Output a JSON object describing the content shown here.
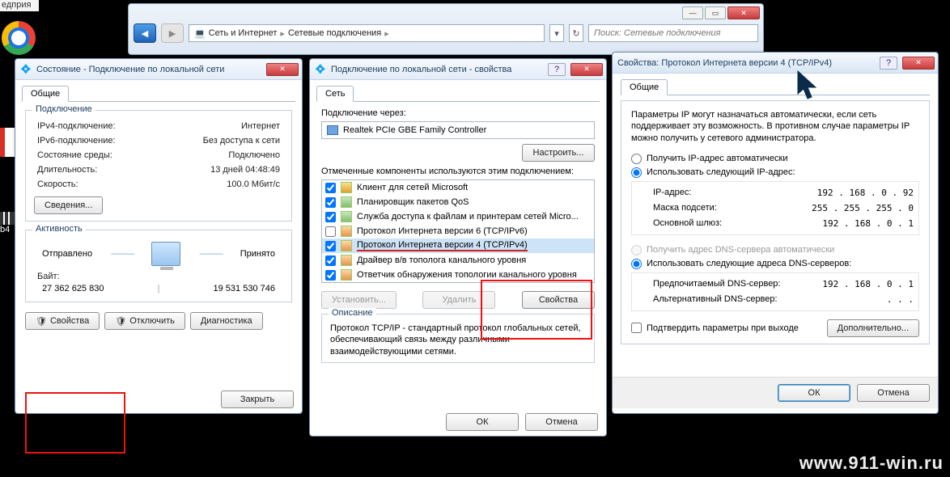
{
  "desktop": {
    "frag": "едприя",
    "b4": "b4"
  },
  "watermark": "www.911-win.ru",
  "explorer": {
    "path1": "Сеть и Интернет",
    "path2": "Сетевые подключения",
    "search_placeholder": "Поиск: Сетевые подключения"
  },
  "status": {
    "title": "Состояние - Подключение по локальной сети",
    "tab": "Общие",
    "grp_connection": "Подключение",
    "ipv4_k": "IPv4-подключение:",
    "ipv4_v": "Интернет",
    "ipv6_k": "IPv6-подключение:",
    "ipv6_v": "Без доступа к сети",
    "media_k": "Состояние среды:",
    "media_v": "Подключено",
    "dur_k": "Длительность:",
    "dur_v": "13 дней 04:48:49",
    "speed_k": "Скорость:",
    "speed_v": "100.0 Мбит/с",
    "details_btn": "Сведения...",
    "grp_activity": "Активность",
    "sent_lbl": "Отправлено",
    "recv_lbl": "Принято",
    "bytes_lbl": "Байт:",
    "bytes_sent": "27 362 625 830",
    "bytes_recv": "19 531 530 746",
    "btn_props": "Свойства",
    "btn_disable": "Отключить",
    "btn_diag": "Диагностика",
    "btn_close": "Закрыть"
  },
  "props": {
    "title": "Подключение по локальной сети - свойства",
    "tab": "Сеть",
    "connect_via": "Подключение через:",
    "adapter": "Realtek PCIe GBE Family Controller",
    "btn_configure": "Настроить...",
    "comp_label": "Отмеченные компоненты используются этим подключением:",
    "components": [
      {
        "checked": true,
        "label": "Клиент для сетей Microsoft"
      },
      {
        "checked": true,
        "label": "Планировщик пакетов QoS"
      },
      {
        "checked": true,
        "label": "Служба доступа к файлам и принтерам сетей Micro..."
      },
      {
        "checked": false,
        "label": "Протокол Интернета версии 6 (TCP/IPv6)"
      },
      {
        "checked": true,
        "label": "Протокол Интернета версии 4 (TCP/IPv4)",
        "selected": true
      },
      {
        "checked": true,
        "label": "Драйвер в/в тополога канального уровня"
      },
      {
        "checked": true,
        "label": "Ответчик обнаружения топологии канального уровня"
      }
    ],
    "btn_install": "Установить...",
    "btn_remove": "Удалить",
    "btn_cprops": "Свойства",
    "grp_desc": "Описание",
    "desc_txt": "Протокол TCP/IP - стандартный протокол глобальных сетей, обеспечивающий связь между различными взаимодействующими сетями.",
    "btn_ok": "ОК",
    "btn_cancel": "Отмена"
  },
  "ipv4": {
    "title": "Свойства: Протокол Интернета версии 4 (TCP/IPv4)",
    "tab": "Общие",
    "intro": "Параметры IP могут назначаться автоматически, если сеть поддерживает эту возможность. В противном случае параметры IP можно получить у сетевого администратора.",
    "r_auto_ip": "Получить IP-адрес автоматически",
    "r_man_ip": "Использовать следующий IP-адрес:",
    "ip_lbl": "IP-адрес:",
    "ip_val": "192 . 168 .  0  .  92",
    "mask_lbl": "Маска подсети:",
    "mask_val": "255 . 255 . 255 .  0",
    "gw_lbl": "Основной шлюз:",
    "gw_val": "192 . 168 .  0  .  1",
    "r_auto_dns": "Получить адрес DNS-сервера автоматически",
    "r_man_dns": "Использовать следующие адреса DNS-серверов:",
    "dns1_lbl": "Предпочитаемый DNS-сервер:",
    "dns1_val": "192 . 168 .  0  .  1",
    "dns2_lbl": "Альтернативный DNS-сервер:",
    "dns2_val": " .       .       . ",
    "chk_validate": "Подтвердить параметры при выходе",
    "btn_adv": "Дополнительно...",
    "btn_ok": "ОК",
    "btn_cancel": "Отмена"
  }
}
